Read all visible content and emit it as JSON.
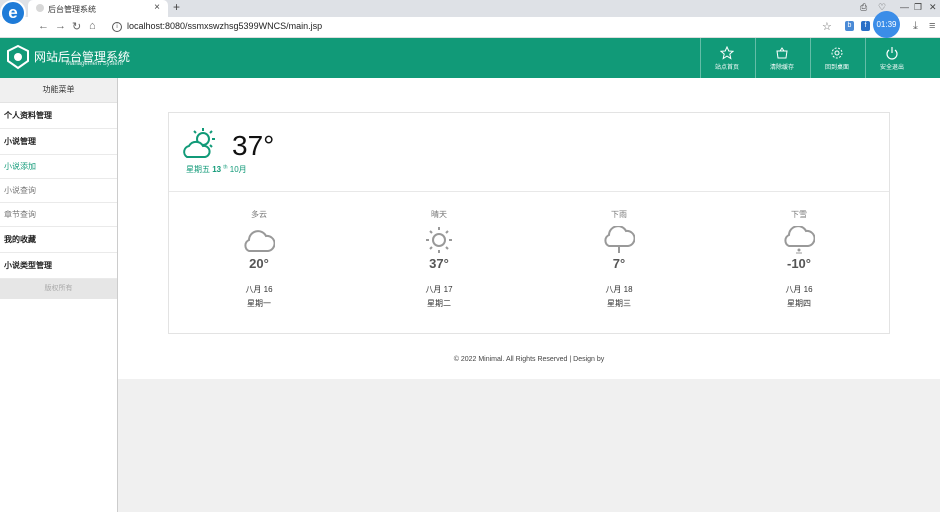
{
  "browser": {
    "logo_letter": "e",
    "tab_title": "后台管理系统",
    "tab_close": "×",
    "new_tab": "+",
    "url": "localhost:8080/ssmxswzhsg5399WNCS/main.jsp",
    "clock": "01:39",
    "nav": {
      "back": "←",
      "forward": "→",
      "reload": "↻",
      "home": "⌂",
      "star": "☆",
      "download": "⤓",
      "menu": "≡"
    },
    "window_controls": {
      "minimize": "—",
      "restore": "❐",
      "close": "✕"
    }
  },
  "header": {
    "title": "网站后台管理系统",
    "subtitle": "Management System",
    "nav": [
      {
        "label": "站点首页",
        "icon": "star-icon"
      },
      {
        "label": "清除缓存",
        "icon": "basket-icon"
      },
      {
        "label": "回到桌面",
        "icon": "gear-icon"
      },
      {
        "label": "安全退出",
        "icon": "power-icon"
      }
    ]
  },
  "sidebar": {
    "heading": "功能菜单",
    "items": [
      {
        "label": "个人资料管理",
        "bold": true
      },
      {
        "label": "小说管理",
        "bold": true
      },
      {
        "label": "小说添加",
        "bold": false,
        "active": true
      },
      {
        "label": "小说查询",
        "bold": false
      },
      {
        "label": "章节查询",
        "bold": false
      },
      {
        "label": "我的收藏",
        "bold": true
      },
      {
        "label": "小说类型管理",
        "bold": true
      }
    ],
    "copyright": "版权所有"
  },
  "weather": {
    "today": {
      "temp": "37°",
      "weekday": "星期五",
      "day": "13",
      "suffix": "th",
      "month": "10月"
    },
    "forecast": [
      {
        "cond": "多云",
        "icon": "cloud-icon",
        "temp": "20°",
        "date": "八月 16",
        "weekday": "星期一"
      },
      {
        "cond": "晴天",
        "icon": "sun-icon",
        "temp": "37°",
        "date": "八月 17",
        "weekday": "星期二"
      },
      {
        "cond": "下雨",
        "icon": "rain-icon",
        "temp": "7°",
        "date": "八月 18",
        "weekday": "星期三"
      },
      {
        "cond": "下雪",
        "icon": "snow-icon",
        "temp": "-10°",
        "date": "八月 16",
        "weekday": "星期四"
      }
    ]
  },
  "footer": {
    "text": "© 2022 Minimal. All Rights Reserved | Design by"
  },
  "colors": {
    "brand": "#119a78",
    "content_bg": "#f0f0f0"
  }
}
